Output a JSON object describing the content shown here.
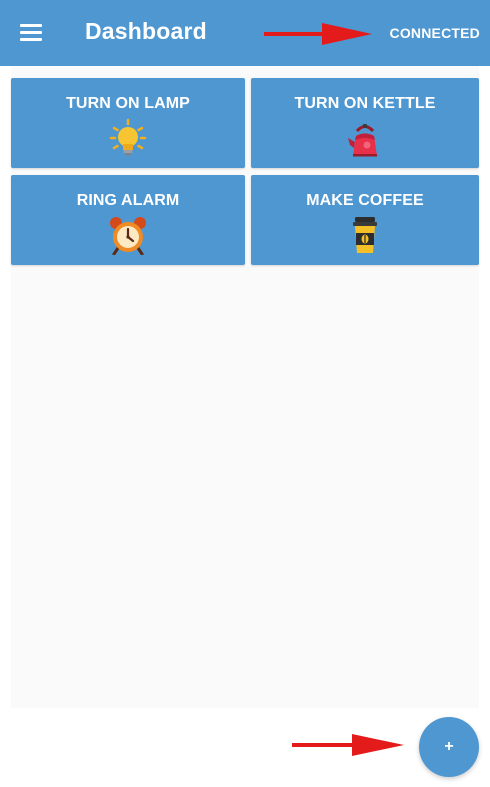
{
  "appbar": {
    "title": "Dashboard",
    "status": "CONNECTED",
    "menu_icon": "hamburger-menu-icon"
  },
  "tiles": [
    {
      "label": "TURN ON LAMP",
      "icon": "light-bulb-icon"
    },
    {
      "label": "TURN ON KETTLE",
      "icon": "kettle-icon"
    },
    {
      "label": "RING ALARM",
      "icon": "alarm-clock-icon"
    },
    {
      "label": "MAKE COFFEE",
      "icon": "coffee-cup-icon"
    }
  ],
  "fab": {
    "label": "+",
    "icon": "add-icon"
  },
  "colors": {
    "primary": "#4f97d1",
    "arrow": "#e31b1b",
    "content_bg": "#fafafa"
  }
}
